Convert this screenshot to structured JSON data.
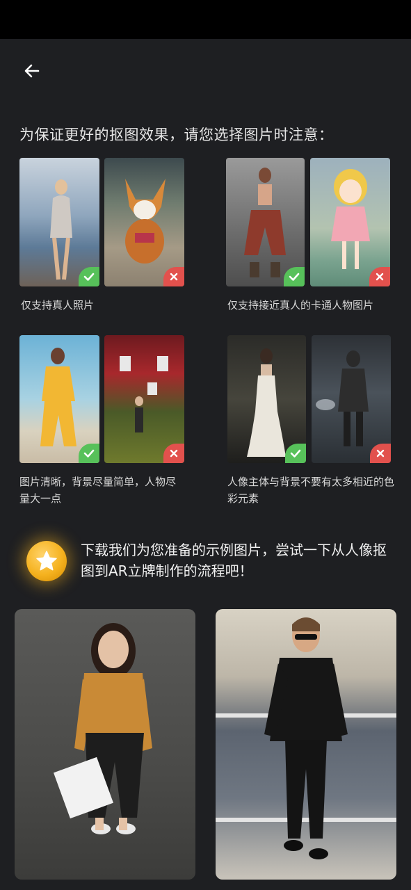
{
  "heading": "为保证更好的抠图效果，请您选择图片时注意：",
  "tips": [
    {
      "caption": "仅支持真人照片"
    },
    {
      "caption": "仅支持接近真人的卡通人物图片"
    },
    {
      "caption": "图片清晰，背景尽量简单，人物尽量大一点"
    },
    {
      "caption": "人像主体与背景不要有太多相近的色彩元素"
    }
  ],
  "promo": {
    "text": "下载我们为您准备的示例图片，尝试一下从人像抠图到AR立牌制作的流程吧！"
  },
  "colors": {
    "ok": "#57c15a",
    "bad": "#e2514d",
    "background": "#1e1f22"
  },
  "icons": {
    "back": "arrow-left-icon",
    "ok": "check-icon",
    "bad": "close-icon",
    "promo": "star-icon"
  }
}
